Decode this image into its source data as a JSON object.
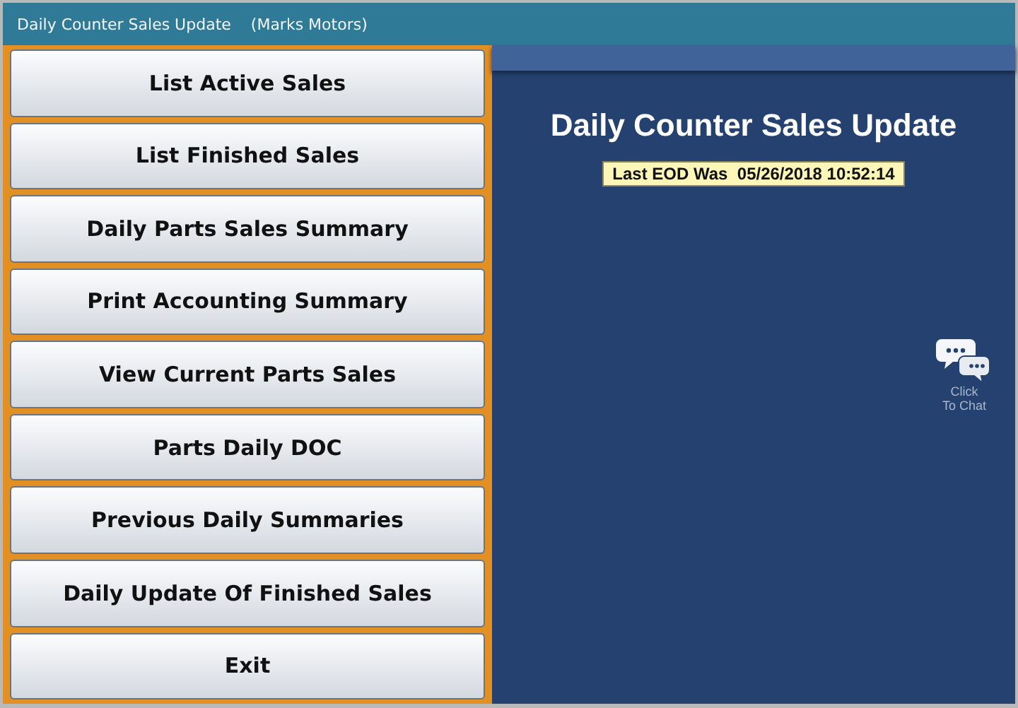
{
  "window": {
    "title": "Daily Counter Sales Update",
    "subtitle": "(Marks Motors)"
  },
  "menu_buttons": [
    "List Active Sales",
    "List Finished Sales",
    "Daily Parts Sales Summary",
    "Print Accounting Summary",
    "View Current Parts Sales",
    "Parts Daily DOC",
    "Previous Daily Summaries",
    "Daily Update Of Finished Sales",
    "Exit"
  ],
  "heading": "Daily Counter Sales Update",
  "last_eod": "Last EOD Was  05/26/2018 10:52:14",
  "chat": {
    "label_line_1": "Click",
    "label_line_2": "To Chat"
  }
}
